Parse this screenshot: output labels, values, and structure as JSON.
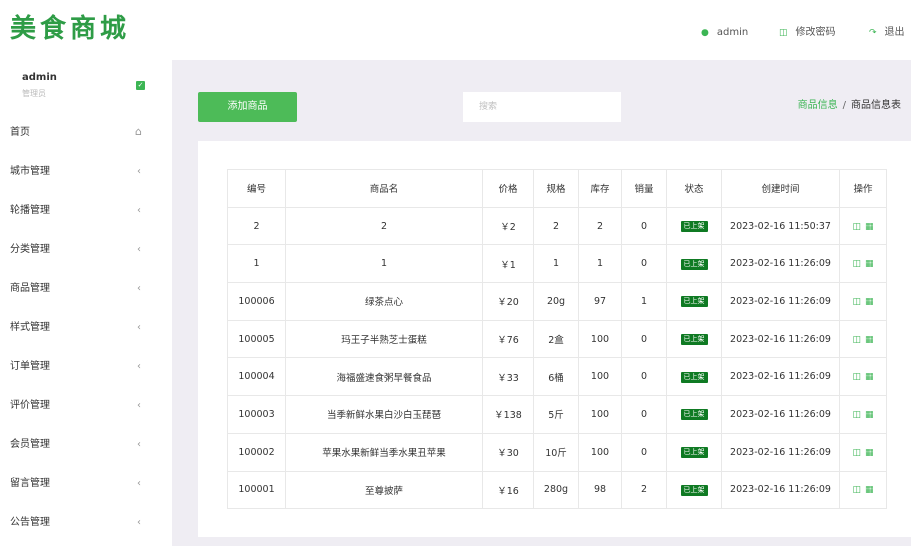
{
  "header": {
    "logo": "美食商城",
    "user": "admin",
    "change_password": "修改密码",
    "logout": "退出"
  },
  "sidebar": {
    "user_name": "admin",
    "user_role": "管理员",
    "items": [
      {
        "label": "首页",
        "icon": "home-icon"
      },
      {
        "label": "城市管理",
        "icon": "chevron-left-icon"
      },
      {
        "label": "轮播管理",
        "icon": "chevron-left-icon"
      },
      {
        "label": "分类管理",
        "icon": "chevron-left-icon"
      },
      {
        "label": "商品管理",
        "icon": "chevron-left-icon"
      },
      {
        "label": "样式管理",
        "icon": "chevron-left-icon"
      },
      {
        "label": "订单管理",
        "icon": "chevron-left-icon"
      },
      {
        "label": "评价管理",
        "icon": "chevron-left-icon"
      },
      {
        "label": "会员管理",
        "icon": "chevron-left-icon"
      },
      {
        "label": "留言管理",
        "icon": "chevron-left-icon"
      },
      {
        "label": "公告管理",
        "icon": "chevron-left-icon"
      }
    ]
  },
  "toolbar": {
    "add_label": "添加商品",
    "search_placeholder": "搜索"
  },
  "breadcrumb": {
    "parent": "商品信息",
    "separator": "/",
    "current": "商品信息表"
  },
  "table": {
    "headers": [
      "编号",
      "商品名",
      "价格",
      "规格",
      "库存",
      "销量",
      "状态",
      "创建时间",
      "操作"
    ],
    "rows": [
      [
        "2",
        "2",
        "￥2",
        "2",
        "2",
        "0",
        "已上架",
        "2023-02-16 11:50:37"
      ],
      [
        "1",
        "1",
        "￥1",
        "1",
        "1",
        "0",
        "已上架",
        "2023-02-16 11:26:09"
      ],
      [
        "100006",
        "绿茶点心",
        "￥20",
        "20g",
        "97",
        "1",
        "已上架",
        "2023-02-16 11:26:09"
      ],
      [
        "100005",
        "玛王子半熟芝士蛋糕",
        "￥76",
        "2盒",
        "100",
        "0",
        "已上架",
        "2023-02-16 11:26:09"
      ],
      [
        "100004",
        "海福盛速食粥早餐食品",
        "￥33",
        "6桶",
        "100",
        "0",
        "已上架",
        "2023-02-16 11:26:09"
      ],
      [
        "100003",
        "当季新鲜水果白沙白玉琵琶",
        "￥138",
        "5斤",
        "100",
        "0",
        "已上架",
        "2023-02-16 11:26:09"
      ],
      [
        "100002",
        "苹果水果新鲜当季水果丑苹果",
        "￥30",
        "10斤",
        "100",
        "0",
        "已上架",
        "2023-02-16 11:26:09"
      ],
      [
        "100001",
        "至尊披萨",
        "￥16",
        "280g",
        "98",
        "2",
        "已上架",
        "2023-02-16 11:26:09"
      ]
    ]
  },
  "colors": {
    "accent": "#4dbb58",
    "logo": "#2e9c46",
    "status": "#0f7a23",
    "background": "#efedf3"
  }
}
